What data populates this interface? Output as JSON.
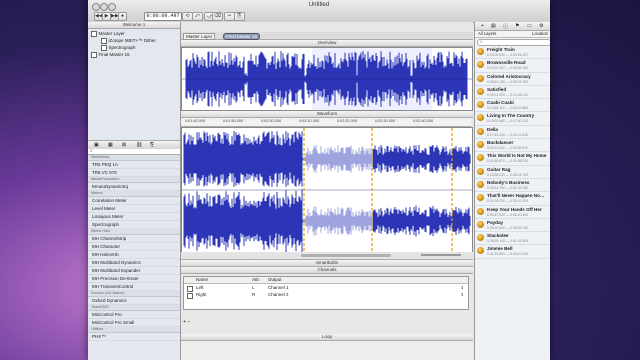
{
  "window": {
    "title": "Untitled",
    "time": "0:00:09.497"
  },
  "toolbar": {
    "buttons": [
      "◀◀",
      "▶",
      "▶▶",
      "●",
      "⟲",
      "⤺",
      "⤻",
      "⌫",
      "✂",
      "⎘"
    ]
  },
  "left": {
    "tab": "Welcome 1",
    "tree": [
      {
        "label": "Master Layer",
        "indent": 0
      },
      {
        "label": "iZotope MBIT+™ Dither",
        "indent": 1
      },
      {
        "label": "Spectrograph",
        "indent": 1
      },
      {
        "label": "Final Master 16",
        "indent": 0
      }
    ],
    "plugins": [
      {
        "section": "Multimedia",
        "items": [
          "TR5 PEQ 1A",
          "TR5 VC 670"
        ]
      },
      {
        "section": "MeldaProduction",
        "items": [
          "MAutoDynamicEq"
        ]
      },
      {
        "section": "Meters",
        "items": [
          "Correlation Meter",
          "Level Meter",
          "Lissajous Meter",
          "Spectrograph"
        ]
      },
      {
        "section": "Metric Halo",
        "items": [
          "MH ChannelStrip",
          "MH Character",
          "MH HaloVerb",
          "MH Multiband Dynamics",
          "MH Multiband Expander",
          "MH Precision De-Esser",
          "MH TransientControl"
        ]
      },
      {
        "section": "Sonnox (AU Native)",
        "items": [
          "Oxford Dynamics"
        ]
      },
      {
        "section": "TeamDMR",
        "items": [
          "MixControl Pro",
          "MixControl Pro Small"
        ]
      },
      {
        "section": "Utilities",
        "items": [
          "PHX™"
        ]
      }
    ]
  },
  "center": {
    "tabs": [
      "Master Layer",
      "Final Master 16"
    ],
    "overview_label": "Overview",
    "waveform_label": "Waveform",
    "ruler": [
      "0:01:40.000",
      "0:01:50.000",
      "0:02:00.000",
      "0:02:10.000",
      "0:02:20.000",
      "0:02:30.000",
      "0:02:40.000"
    ],
    "smartedits_label": "SmartEdits",
    "channels_label": "Channels",
    "channels_headers": [
      "Name",
      "Attr.",
      "Output"
    ],
    "channels": [
      {
        "name": "Left",
        "attr": "L",
        "output": "Channel 1"
      },
      {
        "name": "Right",
        "attr": "R",
        "output": "Channel 2"
      }
    ],
    "loop_label": "Loop"
  },
  "right": {
    "filter": "All Layers",
    "sort": "Location",
    "songs": [
      {
        "title": "Freight Train",
        "sub": "0:00:00.000 — 0:03:21.427"
      },
      {
        "title": "Brownsville Road",
        "sub": "0:03:21.427 — 0:06:54.180"
      },
      {
        "title": "Colored Aristocracy",
        "sub": "0:06:54.180 — 0:09:31.920"
      },
      {
        "title": "Satisfied",
        "sub": "0:09:31.920 — 0:12:48.110"
      },
      {
        "title": "Cuabi Cuabi",
        "sub": "0:12:48.110 — 0:15:02.660"
      },
      {
        "title": "Living In The Country",
        "sub": "0:15:02.660 — 0:17:40.210"
      },
      {
        "title": "Della",
        "sub": "0:17:40.210 — 0:20:11.540"
      },
      {
        "title": "Buckdancer",
        "sub": "0:20:11.540 — 0:22:59.870"
      },
      {
        "title": "This World Is Not My Home",
        "sub": "0:22:59.870 — 0:25:38.020"
      },
      {
        "title": "Guitar Rag",
        "sub": "0:25:38.020 — 0:28:14.760"
      },
      {
        "title": "Nobody's Business",
        "sub": "0:28:14.760 — 0:31:03.330"
      },
      {
        "title": "That'll Never Happen No…",
        "sub": "0:31:03.330 — 0:33:47.910"
      },
      {
        "title": "Keep Your Hands Off Her",
        "sub": "0:33:47.910 — 0:36:20.450"
      },
      {
        "title": "Payday",
        "sub": "0:36:20.450 — 0:38:55.140"
      },
      {
        "title": "Stackolee",
        "sub": "0:38:55.140 — 0:41:31.800"
      },
      {
        "title": "Jimmie Bell",
        "sub": "0:41:31.800 — 0:44:10.230"
      }
    ]
  },
  "colors": {
    "wave": "#2b35b5",
    "marker": "#e0a000",
    "selection": "#ffffff"
  }
}
